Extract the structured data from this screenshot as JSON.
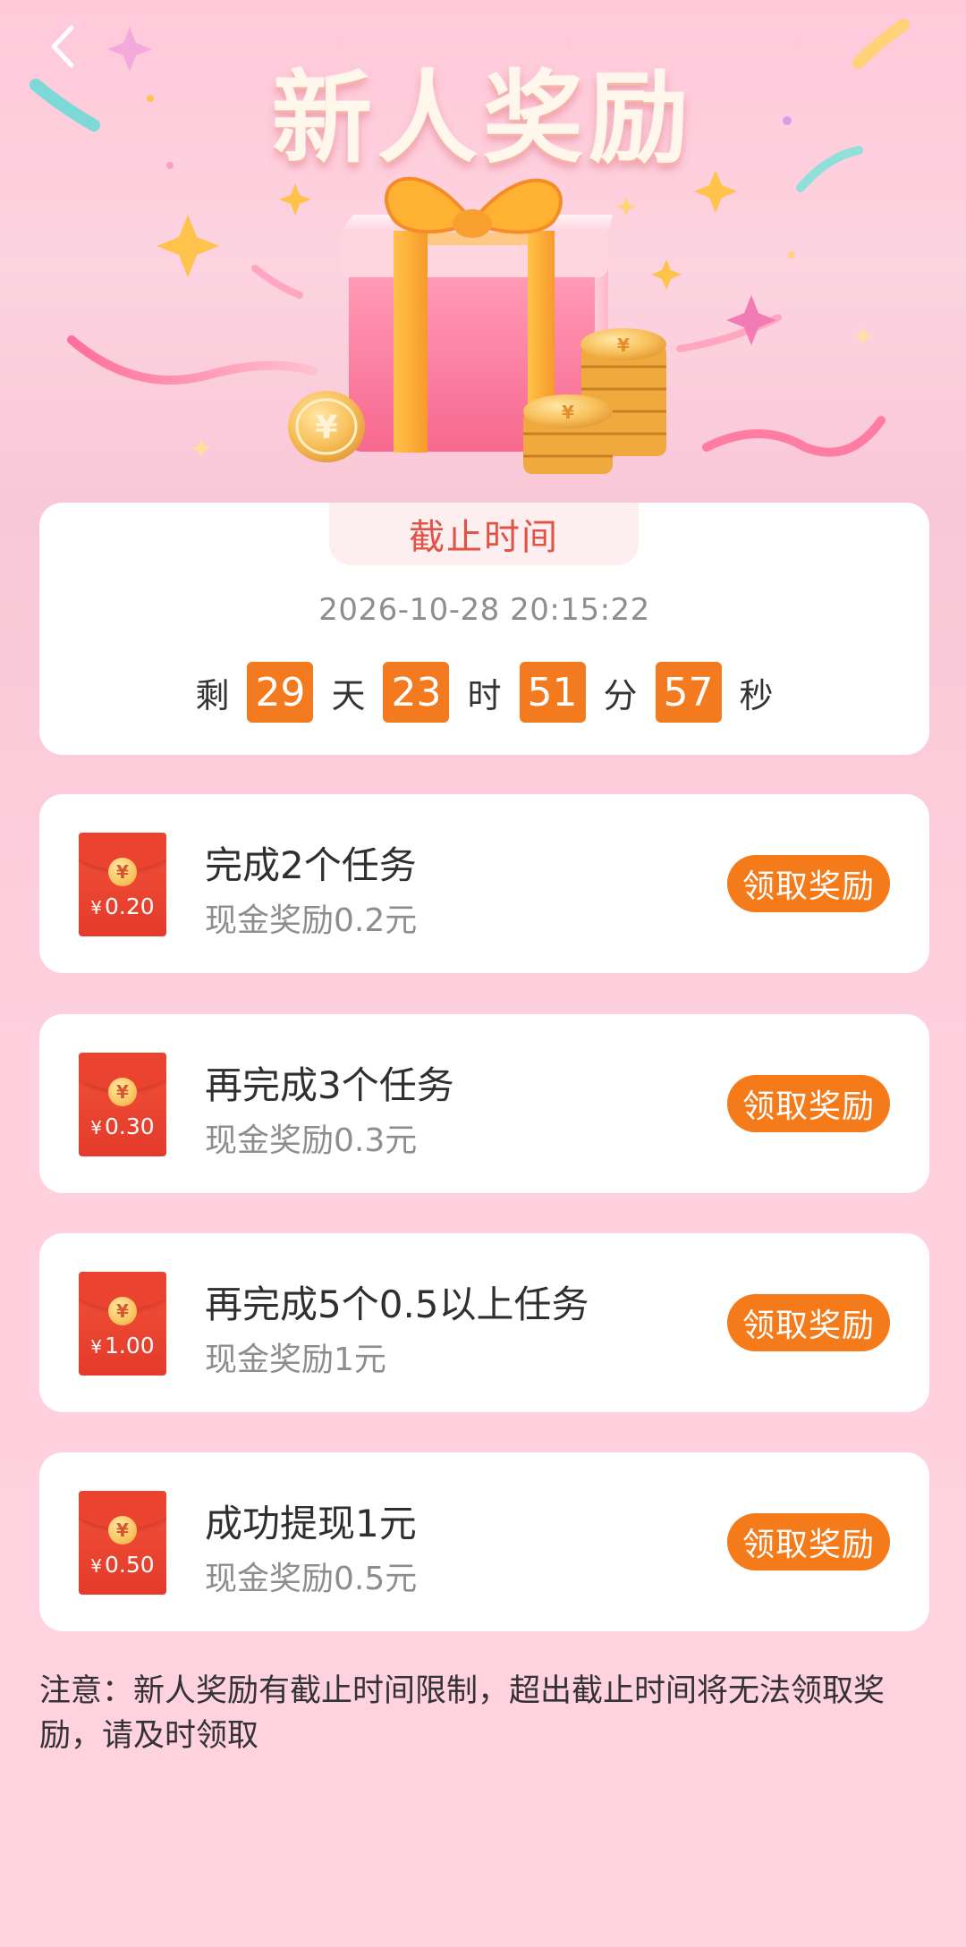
{
  "header": {
    "title": "新人奖励",
    "back_icon": "chevron-left-icon"
  },
  "countdown": {
    "label": "截止时间",
    "deadline": "2026-10-28 20:15:22",
    "prefix": "剩",
    "days": "29",
    "days_unit": "天",
    "hours": "23",
    "hours_unit": "时",
    "minutes": "51",
    "minutes_unit": "分",
    "seconds": "57",
    "seconds_unit": "秒"
  },
  "tasks": [
    {
      "packet_amount": "0.20",
      "title": "完成2个任务",
      "reward": "现金奖励0.2元",
      "button": "领取奖励"
    },
    {
      "packet_amount": "0.30",
      "title": "再完成3个任务",
      "reward": "现金奖励0.3元",
      "button": "领取奖励"
    },
    {
      "packet_amount": "1.00",
      "title": "再完成5个0.5以上任务",
      "reward": "现金奖励1元",
      "button": "领取奖励"
    },
    {
      "packet_amount": "0.50",
      "title": "成功提现1元",
      "reward": "现金奖励0.5元",
      "button": "领取奖励"
    }
  ],
  "currency_symbol": "¥",
  "notice": "注意：新人奖励有截止时间限制，超出截止时间将无法领取奖励，请及时领取",
  "colors": {
    "accent_orange": "#f47a1a",
    "deadline_red": "#e25245",
    "packet_red": "#e43a2a",
    "background_pink": "#ffd3e0"
  }
}
